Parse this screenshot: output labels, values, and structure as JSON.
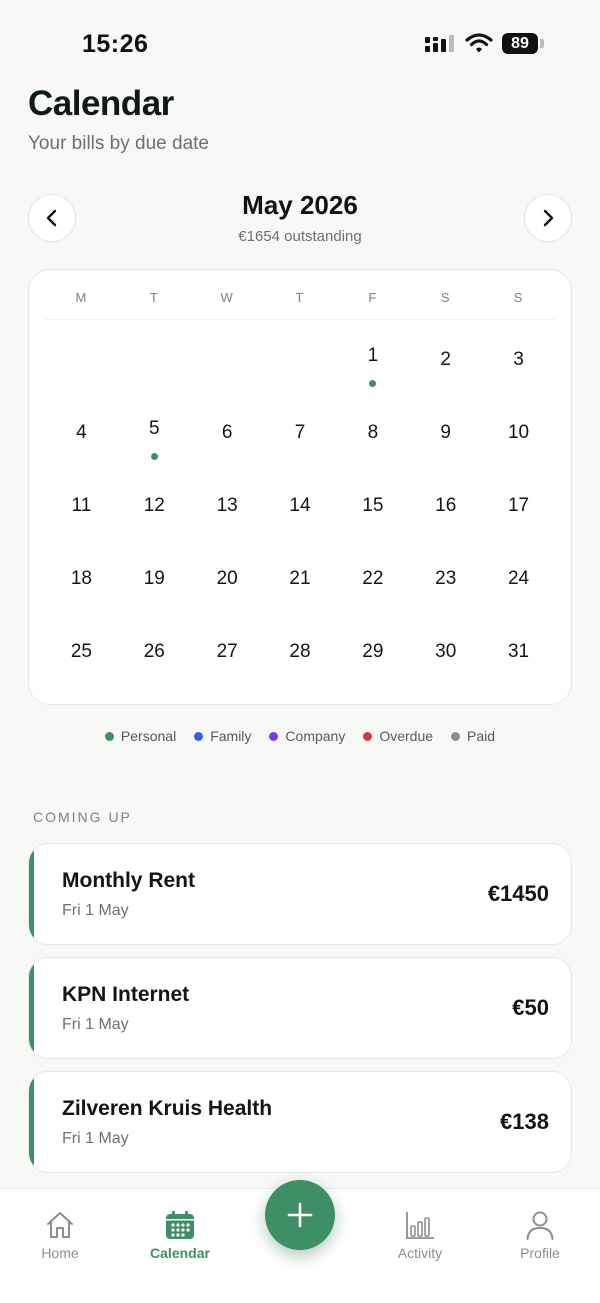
{
  "status_bar": {
    "time": "15:26",
    "battery": "89"
  },
  "header": {
    "title": "Calendar",
    "subtitle": "Your bills by due date"
  },
  "month_nav": {
    "month": "May 2026",
    "outstanding": "€1654 outstanding"
  },
  "calendar": {
    "weekdays": [
      "M",
      "T",
      "W",
      "T",
      "F",
      "S",
      "S"
    ],
    "days": [
      {
        "day": "",
        "dot": false
      },
      {
        "day": "",
        "dot": false
      },
      {
        "day": "",
        "dot": false
      },
      {
        "day": "",
        "dot": false
      },
      {
        "day": "1",
        "dot": true
      },
      {
        "day": "2",
        "dot": false
      },
      {
        "day": "3",
        "dot": false
      },
      {
        "day": "4",
        "dot": false
      },
      {
        "day": "5",
        "dot": true
      },
      {
        "day": "6",
        "dot": false
      },
      {
        "day": "7",
        "dot": false
      },
      {
        "day": "8",
        "dot": false
      },
      {
        "day": "9",
        "dot": false
      },
      {
        "day": "10",
        "dot": false
      },
      {
        "day": "11",
        "dot": false
      },
      {
        "day": "12",
        "dot": false
      },
      {
        "day": "13",
        "dot": false
      },
      {
        "day": "14",
        "dot": false
      },
      {
        "day": "15",
        "dot": false
      },
      {
        "day": "16",
        "dot": false
      },
      {
        "day": "17",
        "dot": false
      },
      {
        "day": "18",
        "dot": false
      },
      {
        "day": "19",
        "dot": false
      },
      {
        "day": "20",
        "dot": false
      },
      {
        "day": "21",
        "dot": false
      },
      {
        "day": "22",
        "dot": false
      },
      {
        "day": "23",
        "dot": false
      },
      {
        "day": "24",
        "dot": false
      },
      {
        "day": "25",
        "dot": false
      },
      {
        "day": "26",
        "dot": false
      },
      {
        "day": "27",
        "dot": false
      },
      {
        "day": "28",
        "dot": false
      },
      {
        "day": "29",
        "dot": false
      },
      {
        "day": "30",
        "dot": false
      },
      {
        "day": "31",
        "dot": false
      }
    ],
    "dot_color": "#3e8e66"
  },
  "legend": [
    {
      "label": "Personal",
      "color": "#3e8e66"
    },
    {
      "label": "Family",
      "color": "#3b5fd9"
    },
    {
      "label": "Company",
      "color": "#7c3aed"
    },
    {
      "label": "Overdue",
      "color": "#d23b3b"
    },
    {
      "label": "Paid",
      "color": "#8a8f8d"
    }
  ],
  "coming_up": {
    "label": "COMING UP",
    "bills": [
      {
        "name": "Monthly Rent",
        "date": "Fri 1 May",
        "amount": "€1450"
      },
      {
        "name": "KPN Internet",
        "date": "Fri 1 May",
        "amount": "€50"
      },
      {
        "name": "Zilveren Kruis Health",
        "date": "Fri 1 May",
        "amount": "€138"
      }
    ]
  },
  "tab_bar": {
    "home": "Home",
    "calendar": "Calendar",
    "activity": "Activity",
    "profile": "Profile",
    "active_color": "#3e8e66"
  }
}
